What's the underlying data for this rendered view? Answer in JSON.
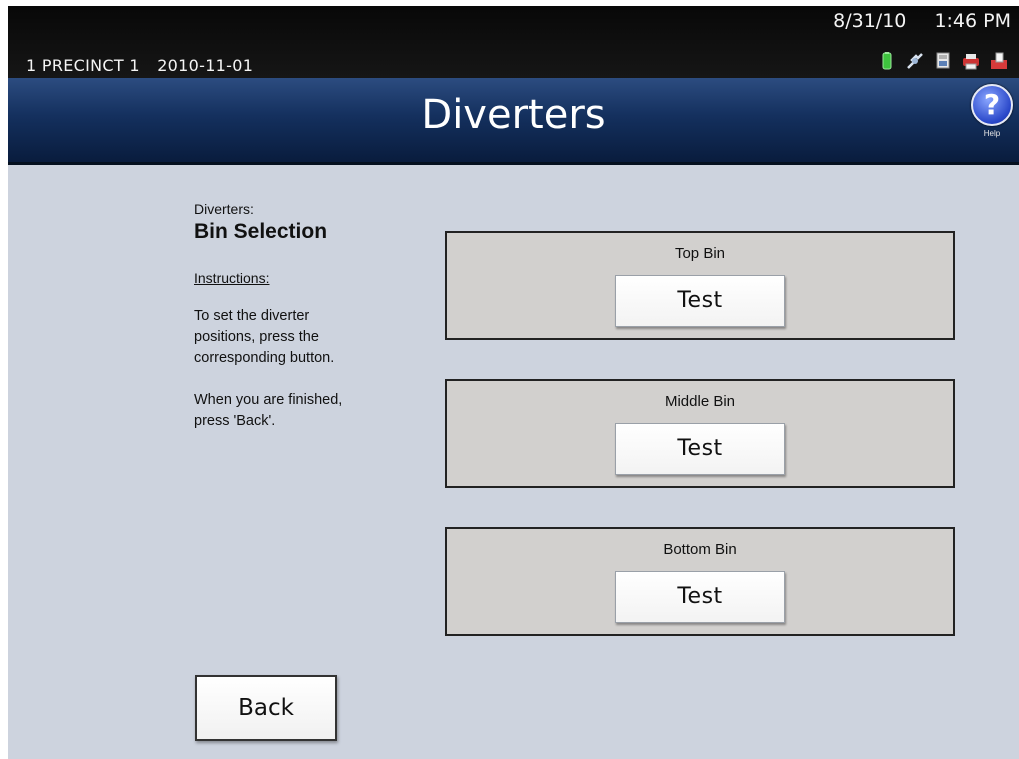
{
  "statusbar": {
    "precinct": "1 PRECINCT 1",
    "election_date": "2010-11-01",
    "date": "8/31/10",
    "time": "1:46 PM",
    "icons": [
      "battery-icon",
      "power-plug-icon",
      "document-icon",
      "printer-icon",
      "ballot-box-icon"
    ]
  },
  "header": {
    "title": "Diverters",
    "help_label": "Help",
    "help_glyph": "?"
  },
  "main": {
    "section_label": "Diverters:",
    "section_title": "Bin Selection",
    "instructions_heading": "Instructions:",
    "instructions_text": "To set the diverter\npositions, press the\ncorresponding button.\n\nWhen you are finished,\npress 'Back'.",
    "bins": [
      {
        "label": "Top Bin",
        "button": "Test"
      },
      {
        "label": "Middle Bin",
        "button": "Test"
      },
      {
        "label": "Bottom Bin",
        "button": "Test"
      }
    ],
    "back_label": "Back"
  },
  "colors": {
    "header_blue": "#14305e",
    "background": "#cdd3de",
    "bin_box": "#d2d0ce",
    "battery_green": "#3ec43e"
  }
}
